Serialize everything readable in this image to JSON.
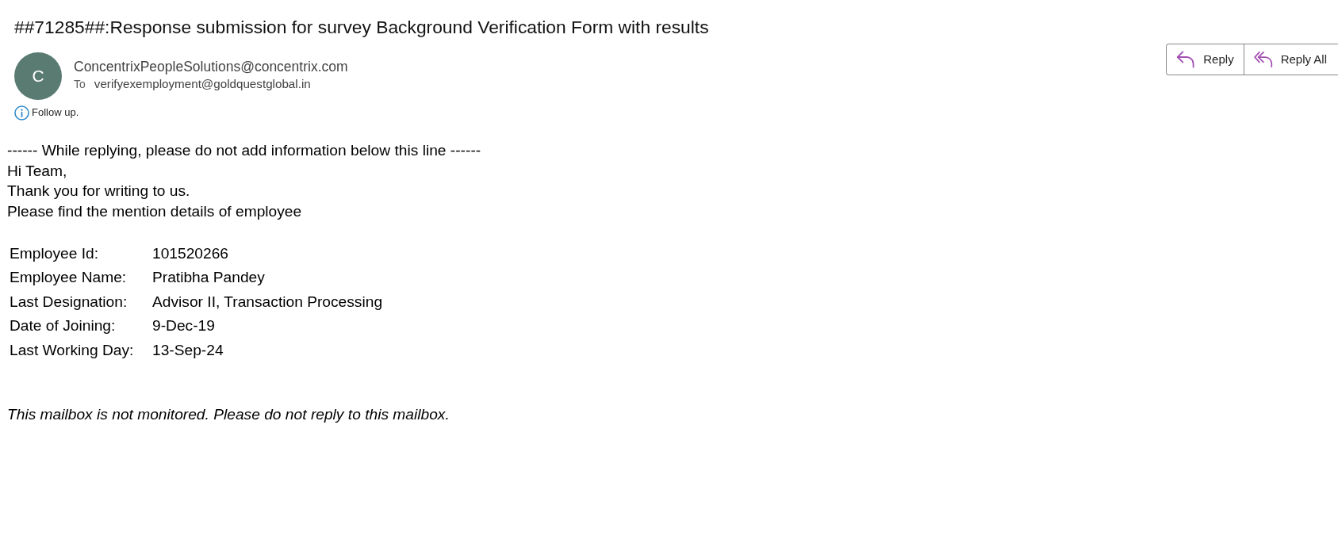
{
  "subject": "##71285##:Response submission for survey Background Verification Form with results",
  "sender": {
    "initial": "C",
    "address": "ConcentrixPeopleSolutions@concentrix.com",
    "to_label": "To",
    "recipients": "verifyexemployment@goldquestglobal.in"
  },
  "flag": {
    "text": "Follow up."
  },
  "actions": [
    {
      "kind": "reply",
      "label": "Reply"
    },
    {
      "kind": "reply_all",
      "label": "Reply All"
    }
  ],
  "body": {
    "separator": "------ While replying, please do not add information below this line ------",
    "lines": [
      "Hi Team,",
      "Thank you for writing to us.",
      "Please find the mention details of employee"
    ],
    "details": [
      {
        "label": "Employee Id:",
        "value": "101520266"
      },
      {
        "label": "Employee Name:",
        "value": "Pratibha Pandey"
      },
      {
        "label": "Last Designation:",
        "value": "Advisor II, Transaction Processing"
      },
      {
        "label": "Date of Joining:",
        "value": "9-Dec-19"
      },
      {
        "label": "Last Working Day:",
        "value": "13-Sep-24"
      }
    ],
    "footer": "This mailbox is not monitored. Please do not reply to this mailbox."
  }
}
